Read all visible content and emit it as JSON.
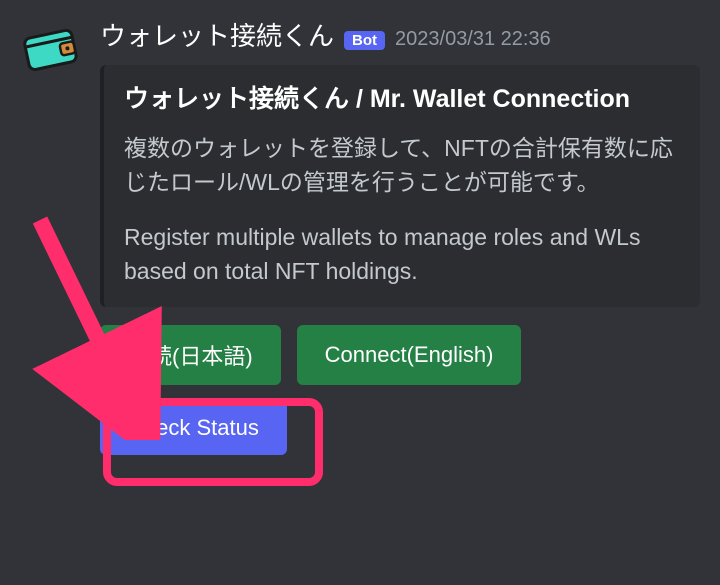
{
  "header": {
    "bot_name": "ウォレット接続くん",
    "bot_badge": "Bot",
    "timestamp": "2023/03/31 22:36"
  },
  "embed": {
    "title": "ウォレット接続くん / Mr. Wallet Connection",
    "desc_jp": "複数のウォレットを登録して、NFTの合計保有数に応じたロール/WLの管理を行うことが可能です。",
    "desc_en": "Register multiple wallets to manage roles and WLs based on total NFT holdings."
  },
  "buttons": {
    "connect_jp": "接続(日本語)",
    "connect_en": "Connect(English)",
    "check_status": "Check Status"
  },
  "colors": {
    "bg": "#313338",
    "embed_bg": "#2b2d31",
    "success": "#248045",
    "primary": "#5865f2",
    "highlight": "#ff2d6b"
  }
}
